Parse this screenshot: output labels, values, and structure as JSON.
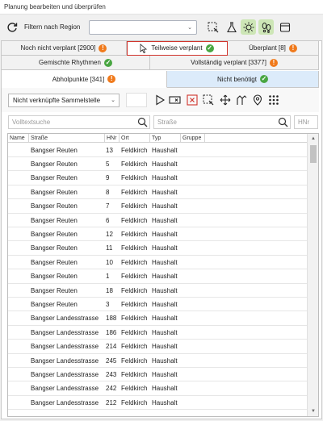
{
  "window": {
    "title": "Planung bearbeiten und überprüfen"
  },
  "toolbar": {
    "region_label": "Filtern nach Region",
    "region_value": "",
    "icons": [
      "refresh-icon",
      "dashed-select-icon",
      "flask-icon",
      "sun-icon",
      "footprints-icon",
      "window-icon"
    ],
    "active_icons": [
      "sun-icon",
      "footprints-icon"
    ]
  },
  "tabs": {
    "row1": [
      {
        "label": "Noch nicht verplant [2900]",
        "status": "warning",
        "status_glyph": "!"
      },
      {
        "label": "Teilweise verplant",
        "status": "ok",
        "status_glyph": "✓",
        "highlighted": true
      },
      {
        "label": "Überplant [8]",
        "status": "warning",
        "status_glyph": "!"
      }
    ],
    "row2": [
      {
        "label": "Gemischte Rhythmen",
        "status": "ok",
        "status_glyph": "✓"
      },
      {
        "label": "Vollständig verplant [3377]",
        "status": "warning",
        "status_glyph": "!"
      }
    ],
    "row3": [
      {
        "label": "Abholpunkte [341]",
        "status": "warning",
        "status_glyph": "!",
        "selected": true
      },
      {
        "label": "Nicht benötigt",
        "status": "ok",
        "status_glyph": "✓"
      }
    ]
  },
  "filterbar": {
    "sammel_select": "Nicht verknüpfte Sammelstelle",
    "icons": [
      "play-icon",
      "tag-icon",
      "delete-icon",
      "dashed-select-icon",
      "move-icon",
      "split-icon",
      "location-pin-icon",
      "grid-dots-icon"
    ]
  },
  "search": {
    "fulltext_placeholder": "Volltextsuche",
    "street_placeholder": "Straße",
    "hnr_placeholder": "HNr"
  },
  "grid": {
    "columns": [
      "Name",
      "Straße",
      "HNr",
      "Ort",
      "Typ",
      "Gruppe"
    ],
    "rows": [
      {
        "name": "",
        "street": "Bangser Reuten",
        "hnr": "13",
        "ort": "Feldkirch",
        "typ": "Haushalt",
        "gruppe": ""
      },
      {
        "name": "",
        "street": "Bangser Reuten",
        "hnr": "5",
        "ort": "Feldkirch",
        "typ": "Haushalt",
        "gruppe": ""
      },
      {
        "name": "",
        "street": "Bangser Reuten",
        "hnr": "9",
        "ort": "Feldkirch",
        "typ": "Haushalt",
        "gruppe": ""
      },
      {
        "name": "",
        "street": "Bangser Reuten",
        "hnr": "8",
        "ort": "Feldkirch",
        "typ": "Haushalt",
        "gruppe": ""
      },
      {
        "name": "",
        "street": "Bangser Reuten",
        "hnr": "7",
        "ort": "Feldkirch",
        "typ": "Haushalt",
        "gruppe": ""
      },
      {
        "name": "",
        "street": "Bangser Reuten",
        "hnr": "6",
        "ort": "Feldkirch",
        "typ": "Haushalt",
        "gruppe": ""
      },
      {
        "name": "",
        "street": "Bangser Reuten",
        "hnr": "12",
        "ort": "Feldkirch",
        "typ": "Haushalt",
        "gruppe": ""
      },
      {
        "name": "",
        "street": "Bangser Reuten",
        "hnr": "11",
        "ort": "Feldkirch",
        "typ": "Haushalt",
        "gruppe": ""
      },
      {
        "name": "",
        "street": "Bangser Reuten",
        "hnr": "10",
        "ort": "Feldkirch",
        "typ": "Haushalt",
        "gruppe": ""
      },
      {
        "name": "",
        "street": "Bangser Reuten",
        "hnr": "1",
        "ort": "Feldkirch",
        "typ": "Haushalt",
        "gruppe": ""
      },
      {
        "name": "",
        "street": "Bangser Reuten",
        "hnr": "18",
        "ort": "Feldkirch",
        "typ": "Haushalt",
        "gruppe": ""
      },
      {
        "name": "",
        "street": "Bangser Reuten",
        "hnr": "3",
        "ort": "Feldkirch",
        "typ": "Haushalt",
        "gruppe": ""
      },
      {
        "name": "",
        "street": "Bangser Landesstrasse",
        "hnr": "188",
        "ort": "Feldkirch",
        "typ": "Haushalt",
        "gruppe": ""
      },
      {
        "name": "",
        "street": "Bangser Landesstrasse",
        "hnr": "186",
        "ort": "Feldkirch",
        "typ": "Haushalt",
        "gruppe": ""
      },
      {
        "name": "",
        "street": "Bangser Landesstrasse",
        "hnr": "214",
        "ort": "Feldkirch",
        "typ": "Haushalt",
        "gruppe": ""
      },
      {
        "name": "",
        "street": "Bangser Landesstrasse",
        "hnr": "245",
        "ort": "Feldkirch",
        "typ": "Haushalt",
        "gruppe": ""
      },
      {
        "name": "",
        "street": "Bangser Landesstrasse",
        "hnr": "243",
        "ort": "Feldkirch",
        "typ": "Haushalt",
        "gruppe": ""
      },
      {
        "name": "",
        "street": "Bangser Landesstrasse",
        "hnr": "242",
        "ort": "Feldkirch",
        "typ": "Haushalt",
        "gruppe": ""
      },
      {
        "name": "",
        "street": "Bangser Landesstrasse",
        "hnr": "212",
        "ort": "Feldkirch",
        "typ": "Haushalt",
        "gruppe": ""
      }
    ]
  },
  "colors": {
    "warning": "#f07a1c",
    "ok": "#49a642",
    "highlight": "#d0342c",
    "active_icon_bg": "#cde6b6",
    "selected_tab_blue": "#dcebfa"
  }
}
